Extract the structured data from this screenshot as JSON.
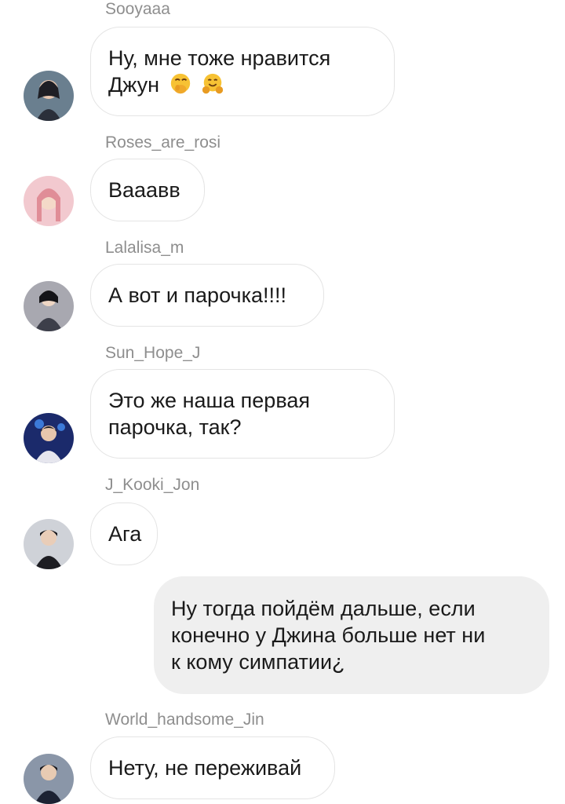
{
  "messages": [
    {
      "sender": "Sooyaaa",
      "lines": [
        "Ну, мне тоже нравится",
        "Джун"
      ],
      "emojis": [
        "hand-over-mouth-emoji",
        "hugging-face-emoji"
      ],
      "avatar": "avatar-sooyaaa",
      "colors": [
        "#2a2f3a",
        "#6a7f8f"
      ]
    },
    {
      "sender": "Roses_are_rosi",
      "lines": [
        "Вааавв"
      ],
      "avatar": "avatar-roses",
      "colors": [
        "#f2c9cf",
        "#e08d97"
      ]
    },
    {
      "sender": "Lalalisa_m",
      "lines": [
        "А вот и парочка!!!!"
      ],
      "avatar": "avatar-lalalisa",
      "colors": [
        "#3d3f4a",
        "#a8a8b0"
      ]
    },
    {
      "sender": "Sun_Hope_J",
      "lines": [
        "Это же наша первая",
        "парочка, так?"
      ],
      "avatar": "avatar-sun-hope",
      "colors": [
        "#1b2a6b",
        "#3c7ad8"
      ]
    },
    {
      "sender": "J_Kooki_Jon",
      "lines": [
        "Ага"
      ],
      "avatar": "avatar-jkooki",
      "colors": [
        "#1d1d22",
        "#cfd2d8"
      ]
    },
    {
      "sender": "",
      "outgoing": true,
      "lines": [
        "Ну тогда пойдём дальше, если",
        "конечно у Джина больше нет ни",
        "к кому симпатии¿"
      ]
    },
    {
      "sender": "World_handsome_Jin",
      "lines": [
        "Нету, не переживай"
      ],
      "avatar": "avatar-world-jin",
      "colors": [
        "#1c2233",
        "#8a96a8"
      ]
    }
  ]
}
